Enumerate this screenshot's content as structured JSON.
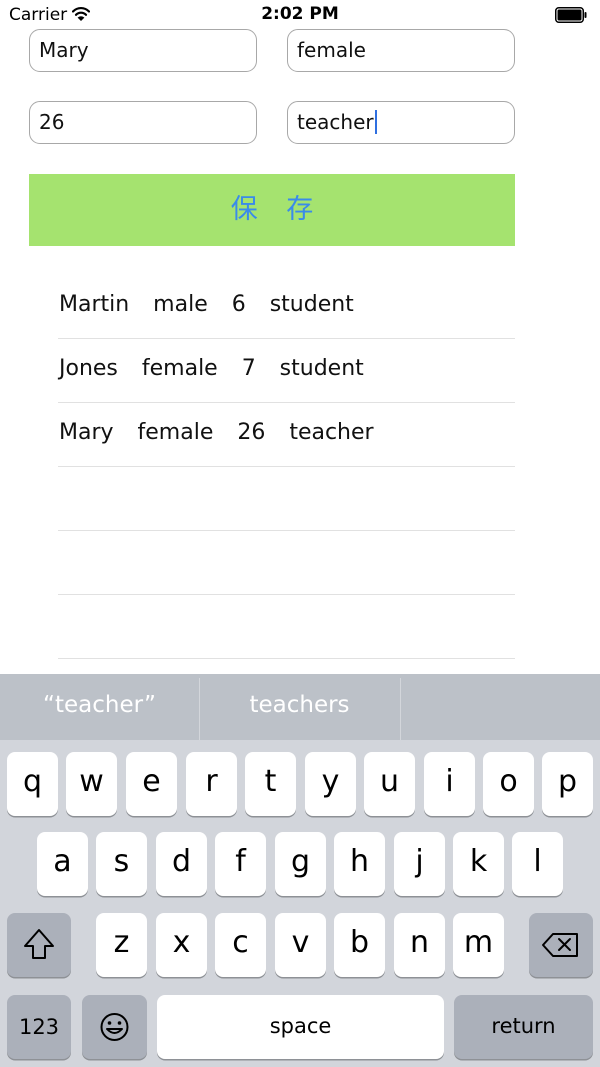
{
  "status_bar": {
    "carrier": "Carrier",
    "time": "2:02 PM"
  },
  "form": {
    "name_value": "Mary",
    "gender_value": "female",
    "age_value": "26",
    "job_value": "teacher",
    "save_label": "保 存"
  },
  "records": [
    {
      "text": "Martin  male  6  student"
    },
    {
      "text": "Jones  female  7  student"
    },
    {
      "text": "Mary  female  26  teacher"
    },
    {
      "text": ""
    },
    {
      "text": ""
    },
    {
      "text": ""
    }
  ],
  "suggestions": [
    "“teacher”",
    "teachers",
    ""
  ],
  "keyboard": {
    "row1": [
      "q",
      "w",
      "e",
      "r",
      "t",
      "y",
      "u",
      "i",
      "o",
      "p"
    ],
    "row2": [
      "a",
      "s",
      "d",
      "f",
      "g",
      "h",
      "j",
      "k",
      "l"
    ],
    "row3": [
      "z",
      "x",
      "c",
      "v",
      "b",
      "n",
      "m"
    ],
    "numbers_label": "123",
    "space_label": "space",
    "return_label": "return"
  },
  "colors": {
    "save_button_bg": "#a5e36f",
    "save_button_text": "#3a8bea",
    "cursor": "#2f6fe0",
    "keyboard_bg": "#d2d5db",
    "suggestion_bar_bg": "#bcc1c8"
  },
  "icons": {
    "signal": "wifi-icon",
    "battery": "battery-icon",
    "shift": "shift-icon",
    "delete": "delete-icon",
    "emoji": "emoji-icon"
  }
}
